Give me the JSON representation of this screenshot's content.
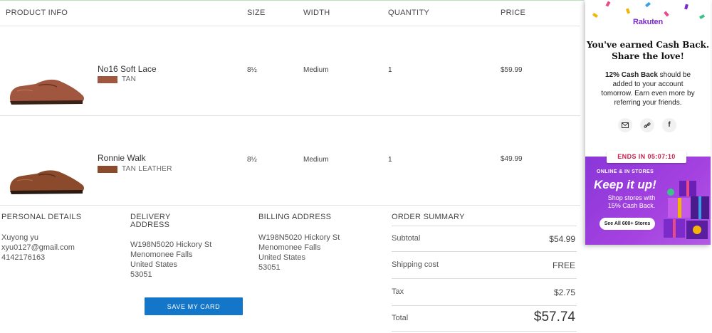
{
  "columns": {
    "product_info": "PRODUCT INFO",
    "size": "SIZE",
    "width": "WIDTH",
    "quantity": "QUANTITY",
    "price": "PRICE"
  },
  "products": [
    {
      "name": "No16 Soft Lace",
      "color_name": "TAN",
      "swatch": "#a0563f",
      "size": "8½",
      "width": "Medium",
      "quantity": "1",
      "price": "$59.99"
    },
    {
      "name": "Ronnie Walk",
      "color_name": "TAN LEATHER",
      "swatch": "#8b4a2b",
      "size": "8½",
      "width": "Medium",
      "quantity": "1",
      "price": "$49.99"
    }
  ],
  "personal": {
    "heading": "PERSONAL DETAILS",
    "name": "Xuyong  yu",
    "email": "xyu0127@gmail.com",
    "phone": "4142176163"
  },
  "delivery": {
    "heading_1": "DELIVERY",
    "heading_2": "ADDRESS",
    "street": "W198N5020 Hickory St",
    "city": "Menomonee Falls",
    "country": "United States",
    "zip": "53051"
  },
  "billing": {
    "heading": "BILLING ADDRESS",
    "street": "W198N5020 Hickory St",
    "city": "Menomonee Falls",
    "country": "United States",
    "zip": "53051"
  },
  "summary": {
    "heading": "ORDER SUMMARY",
    "subtotal_label": "Subtotal",
    "subtotal": "$54.99",
    "shipping_label": "Shipping cost",
    "shipping": "FREE",
    "tax_label": "Tax",
    "tax": "$2.75",
    "total_label": "Total",
    "total": "$57.74"
  },
  "save_card_label": "SAVE MY CARD",
  "rakuten": {
    "logo": "Rakuten",
    "title_1": "You've earned Cash Back.",
    "title_2": "Share the love!",
    "body_bold": "12% Cash Back",
    "body_1": " should be",
    "body_2": "added to your account",
    "body_3": "tomorrow. Earn even more by",
    "body_4": "referring your friends.",
    "ends": "ENDS IN 05:07:10",
    "promo_small": "ONLINE & IN STORES",
    "promo_big": "Keep it up!",
    "promo_sub_1": "Shop stores with",
    "promo_sub_2": "15% Cash Back.",
    "stores_button": "See All 600+ Stores",
    "icons": [
      "email-icon",
      "link-icon",
      "facebook-icon"
    ],
    "accent": "#7a2bc9",
    "ends_color": "#cc1f4b"
  },
  "colors": {
    "button_blue": "#1476c9"
  }
}
